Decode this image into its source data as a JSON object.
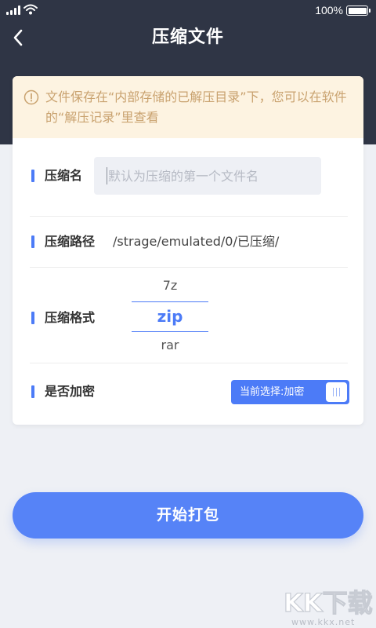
{
  "status_bar": {
    "battery_text": "100%"
  },
  "nav": {
    "title": "压缩文件",
    "back_icon": "chevron-left-icon"
  },
  "notice": {
    "icon": "info-circle-icon",
    "text": "文件保存在“内部存储的已解压目录”下，您可以在软件的“解压记录”里查看"
  },
  "form": {
    "name": {
      "label": "压缩名",
      "placeholder": "默认为压缩的第一个文件名",
      "value": ""
    },
    "path": {
      "label": "压缩路径",
      "value": "/strage/emulated/0/已压缩/"
    },
    "format": {
      "label": "压缩格式",
      "options": [
        "7z",
        "zip",
        "rar"
      ],
      "selected": "zip"
    },
    "encrypt": {
      "label": "是否加密",
      "toggle_text": "当前选择:加密",
      "enabled": true
    }
  },
  "actions": {
    "start_label": "开始打包"
  },
  "colors": {
    "header": "#2f3545",
    "accent": "#4c7bf7",
    "button": "#5683f7",
    "notice_bg": "#fdf3e1",
    "notice_text": "#c9a26f"
  },
  "watermark": {
    "logo": "KK下载",
    "url": "www.kkx.net"
  }
}
